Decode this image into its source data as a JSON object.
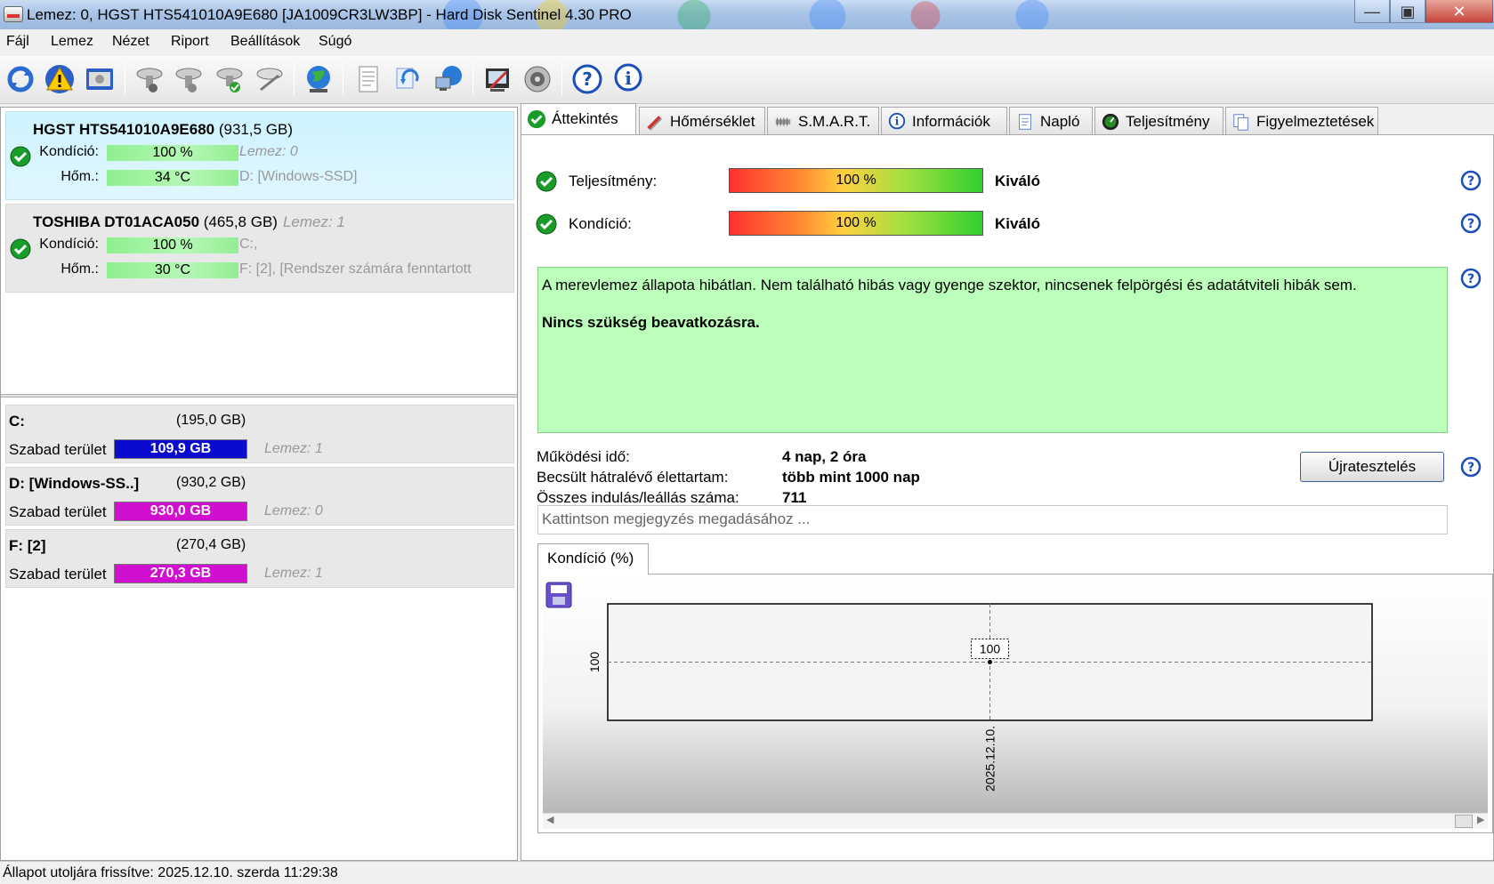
{
  "window": {
    "title": "Lemez: 0, HGST HTS541010A9E680 [JA1009CR3LW3BP]  -  Hard Disk Sentinel 4.30 PRO",
    "min": "—",
    "max": "▣",
    "close": "✕"
  },
  "menu": [
    "Fájl",
    "Lemez",
    "Nézet",
    "Riport",
    "Beállítások",
    "Súgó"
  ],
  "disks": [
    {
      "name": "HGST HTS541010A9E680",
      "capacity": "(931,5 GB)",
      "lemez": "",
      "condition_label": "Kondíció:",
      "condition": "100 %",
      "condition_level": 100,
      "temp_label": "Hőm.:",
      "temp": "34 °C",
      "info1": "Lemez: 0",
      "info2": "D: [Windows-SSD]"
    },
    {
      "name": "TOSHIBA DT01ACA050",
      "capacity": "(465,8 GB)",
      "lemez": "Lemez: 1",
      "condition_label": "Kondíció:",
      "condition": "100 %",
      "condition_level": 100,
      "temp_label": "Hőm.:",
      "temp": "30 °C",
      "info1": "C:,",
      "info2": "F: [2],  [Rendszer számára fenntartott"
    }
  ],
  "partitions": [
    {
      "name": "C:",
      "size": "(195,0 GB)",
      "free_label": "Szabad terület",
      "free": "109,9 GB",
      "lemez": "Lemez: 1",
      "color": "#0b0bd0"
    },
    {
      "name": "D: [Windows-SS..]",
      "size": "(930,2 GB)",
      "free_label": "Szabad terület",
      "free": "930,0 GB",
      "lemez": "Lemez: 0",
      "color": "#d10fd1"
    },
    {
      "name": "F: [2]",
      "size": "(270,4 GB)",
      "free_label": "Szabad terület",
      "free": "270,3 GB",
      "lemez": "Lemez: 1",
      "color": "#d10fd1"
    }
  ],
  "tabs": [
    "Áttekintés",
    "Hőmérséklet",
    "S.M.A.R.T.",
    "Információk",
    "Napló",
    "Teljesítmény",
    "Figyelmeztetések"
  ],
  "overview": {
    "performance_label": "Teljesítmény:",
    "performance_bar": "100 %",
    "performance_level": 100,
    "performance_value": "Kiváló",
    "condition_label": "Kondíció:",
    "condition_bar": "100 %",
    "condition_level": 100,
    "condition_value": "Kiváló",
    "status_line1": "A merevlemez állapota hibátlan. Nem található hibás vagy gyenge szektor, nincsenek felpörgési és adatátviteli hibák sem.",
    "status_line2": "Nincs szükség beavatkozásra.",
    "uptime_label": "Működési idő:",
    "uptime_value": "4 nap, 2 óra",
    "lifetime_label": "Becsült hátralévő élettartam:",
    "lifetime_value": "több mint 1000 nap",
    "startstop_label": "Összes indulás/leállás száma:",
    "startstop_value": "711",
    "retest_button": "Újratesztelés",
    "note_placeholder": "Kattintson megjegyzés megadásához ..."
  },
  "chart_tab": "Kondíció  (%)",
  "chart_data": {
    "type": "line",
    "title": "",
    "xlabel": "",
    "ylabel": "",
    "x": [
      "2025.12.10."
    ],
    "series": [
      {
        "values": [
          100
        ]
      }
    ],
    "y_tick": "100",
    "point_label": "100"
  },
  "statusbar": "Állapot utoljára frissítve: 2025.12.10. szerda 11:29:38",
  "colors": {
    "accent": "#3a5f9f",
    "ok_green": "#1a9c2a",
    "status_bg": "#bbffbb"
  },
  "icons": [
    "refresh-icon",
    "warning-icon",
    "disk-icon",
    "disk-test-icon",
    "disk-test-icon-2",
    "disk-ok-icon",
    "disk-satellite-icon",
    "globe-icon",
    "report-icon",
    "sync-icon",
    "network-icon",
    "edit-icon",
    "speaker-icon",
    "help-icon",
    "info-icon",
    "save-icon"
  ]
}
